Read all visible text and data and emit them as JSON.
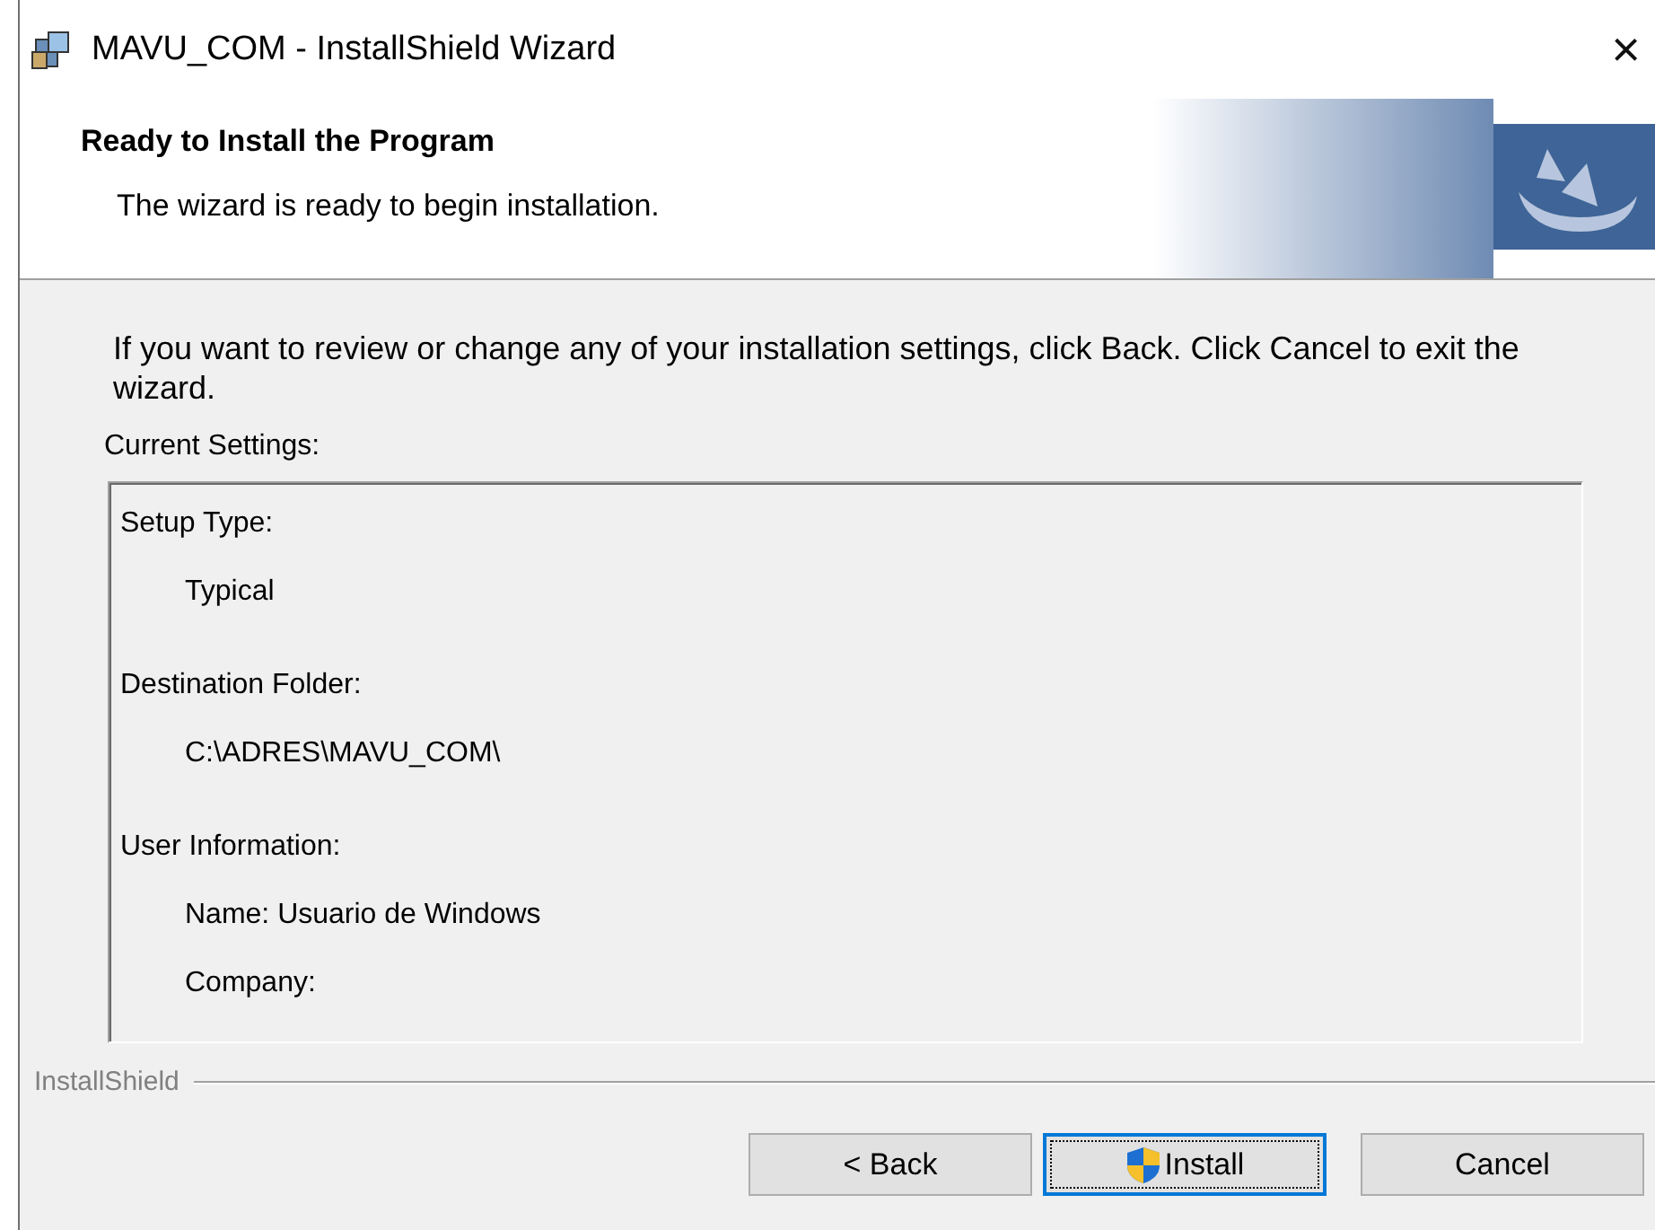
{
  "window": {
    "title": "MAVU_COM - InstallShield Wizard",
    "close": "×"
  },
  "header": {
    "title": "Ready to Install the Program",
    "subtitle": "The wizard is ready to begin installation."
  },
  "intro": "If you want to review or change any of your installation settings, click Back. Click Cancel to exit the wizard.",
  "settings_label": "Current Settings:",
  "settings": [
    {
      "kind": "heading",
      "text": "Setup Type:"
    },
    {
      "kind": "value",
      "text": "Typical"
    },
    {
      "kind": "heading",
      "text": "Destination Folder:"
    },
    {
      "kind": "value",
      "text": "C:\\ADRES\\MAVU_COM\\"
    },
    {
      "kind": "heading",
      "text": "User Information:"
    },
    {
      "kind": "value",
      "text": "Name: Usuario de Windows"
    },
    {
      "kind": "value",
      "text": "Company:"
    }
  ],
  "brand": "InstallShield",
  "buttons": [
    {
      "label": "< Back",
      "kind": "plain",
      "selected": false
    },
    {
      "label": "Install",
      "kind": "shield",
      "selected": true
    },
    {
      "label": "Cancel",
      "kind": "plain",
      "selected": false
    }
  ]
}
